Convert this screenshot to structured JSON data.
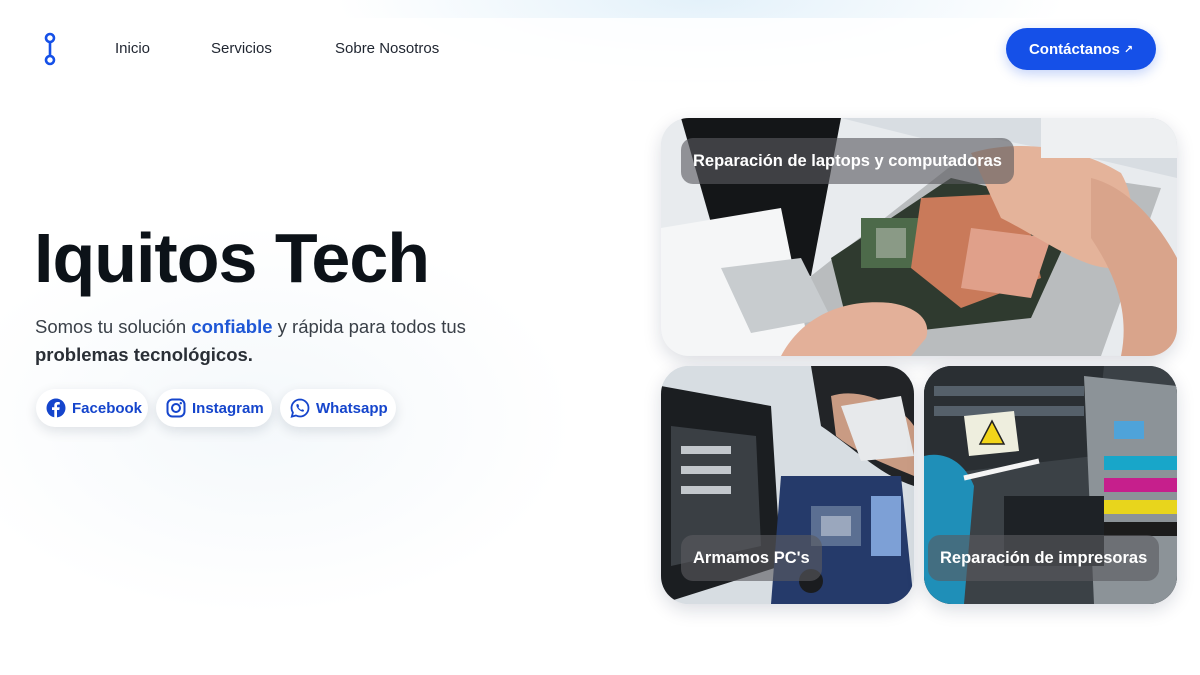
{
  "nav": {
    "links": [
      "Inicio",
      "Servicios",
      "Sobre Nosotros"
    ],
    "cta_label": "Contáctanos",
    "cta_icon": "arrow-up-right-icon"
  },
  "hero": {
    "title": "Iquitos Tech",
    "subtitle_pre": "Somos tu solución ",
    "subtitle_accent": "confiable",
    "subtitle_mid": " y rápida para todos tus ",
    "subtitle_bold": "problemas tecnológicos."
  },
  "social": [
    {
      "label": "Facebook",
      "icon": "facebook-icon"
    },
    {
      "label": "Instagram",
      "icon": "instagram-icon"
    },
    {
      "label": "Whatsapp",
      "icon": "whatsapp-icon"
    }
  ],
  "services": [
    {
      "label": "Reparación de laptops y computadoras",
      "image": "laptop-repair-photo"
    },
    {
      "label": "Armamos PC's",
      "image": "pc-assembly-photo"
    },
    {
      "label": "Reparación de impresoras",
      "image": "printer-repair-photo"
    }
  ],
  "colors": {
    "accent": "#1550e8",
    "title": "#0c1218",
    "link": "#1545cc"
  }
}
